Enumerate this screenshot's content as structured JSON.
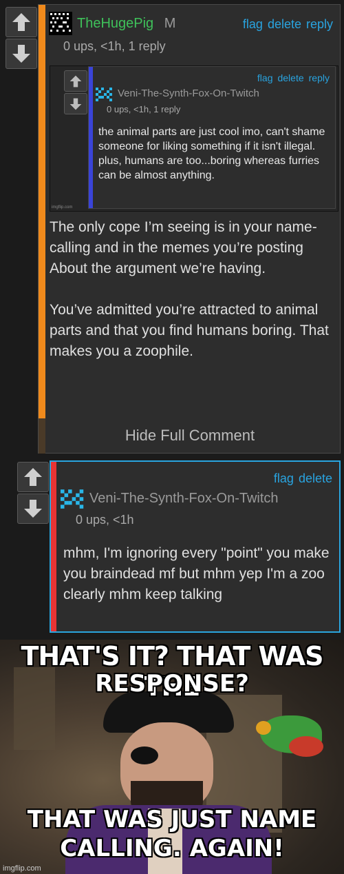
{
  "comment1": {
    "username": "TheHugePig",
    "gender": "M",
    "meta": "0 ups, <1h, 1 reply",
    "actions": {
      "flag": "flag",
      "delete": "delete",
      "reply": "reply"
    },
    "body_p1": "The only cope I’m seeing is in your name-calling and in the memes you’re posting About the argument we’re having.",
    "body_p2": "You’ve admitted you’re attracted to animal parts and that you find humans boring. That makes you a zoophile.",
    "toggle": "Hide Full Comment",
    "accent_color": "#f08a1c",
    "username_color": "#3fc15a"
  },
  "embedded": {
    "username": "Veni-The-Synth-Fox-On-Twitch",
    "meta": "0 ups, <1h, 1 reply",
    "actions": {
      "flag": "flag",
      "delete": "delete",
      "reply": "reply"
    },
    "body": "the animal parts are just cool imo, can't shame someone for liking something if it isn't illegal. plus, humans are too...boring whereas furries can be almost anything.",
    "watermark": "imgflip.com",
    "accent_color": "#3a44d8"
  },
  "comment2": {
    "username": "Veni-The-Synth-Fox-On-Twitch",
    "meta": "0 ups, <1h",
    "actions": {
      "flag": "flag",
      "delete": "delete"
    },
    "body": "mhm, I'm ignoring every \"point\" you make you braindead mf but mhm yep I'm a zoo clearly mhm keep talking",
    "accent_color": "#e83434",
    "border_color": "#2aa6e0"
  },
  "meme": {
    "top_line": "THAT'S IT? THAT WAS THE",
    "middle_line": "RESPONSE?",
    "bottom_line": "THAT WAS JUST NAME CALLING.  AGAIN!",
    "watermark": "imgflip.com"
  },
  "icons": {
    "upvote": "up-arrow-icon",
    "downvote": "down-arrow-icon",
    "avatar": "pixel-avatar-icon"
  }
}
